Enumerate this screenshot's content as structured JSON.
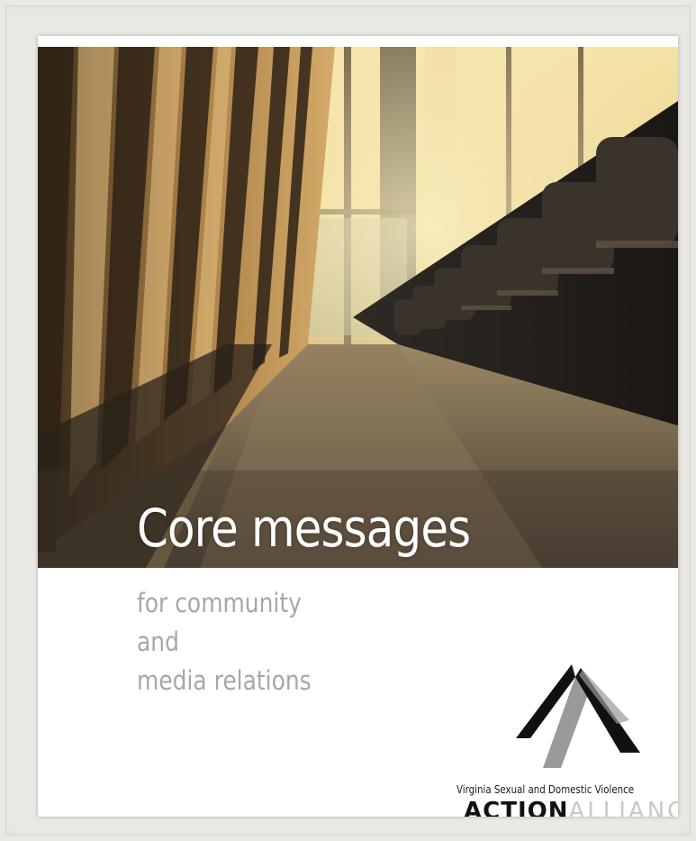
{
  "cover": {
    "title": "Core messages",
    "subtitle_lines": [
      "for community",
      "and",
      "media relations"
    ]
  },
  "logo": {
    "icon": "action-alliance-peak-icon",
    "tagline": "Virginia Sexual and Domestic Violence",
    "word_dark": "ACTION",
    "word_light": "ALLIANCE"
  },
  "photo": {
    "subject": "auditorium-seats-photo"
  },
  "colors": {
    "frame": "#e9e8e2",
    "title": "#ffffff",
    "subtitle": "#a7a7a7",
    "logo_dark": "#111111",
    "logo_gray": "#9a9a9a"
  }
}
